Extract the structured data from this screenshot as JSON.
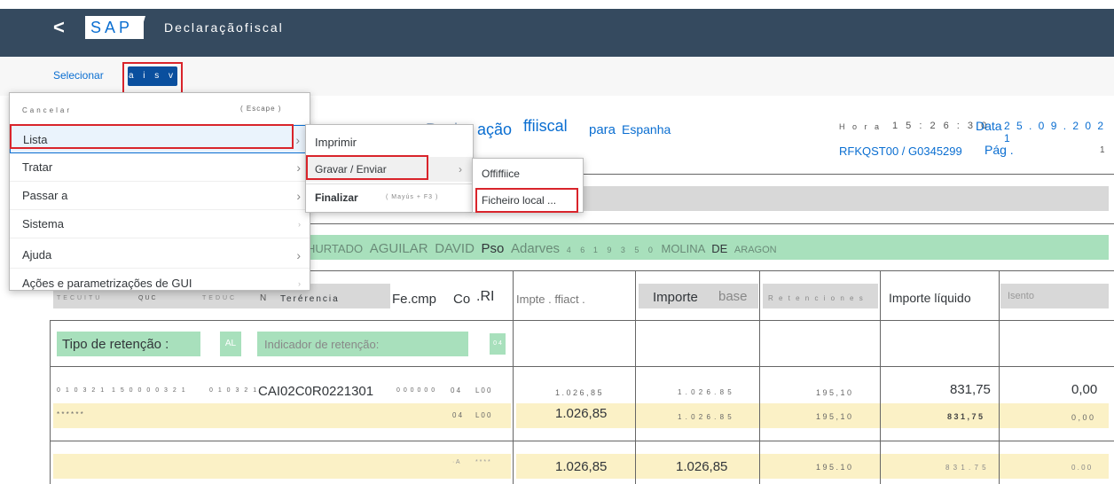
{
  "header": {
    "back_label": "<",
    "logo": "SAP",
    "title": "Declaraçãofiscal"
  },
  "toolbar": {
    "selecionar": "Selecionar",
    "mais": "a i s v"
  },
  "menu": {
    "items": [
      {
        "label": "Cancelar",
        "shortcut": "( Escape )"
      },
      {
        "label": "Lista"
      },
      {
        "label": "Tratar"
      },
      {
        "label": "Passar a"
      },
      {
        "label": "Sistema"
      },
      {
        "label": "Ajuda"
      },
      {
        "label": "Ações e parametrizações de GUI"
      }
    ]
  },
  "submenu1": {
    "items": [
      {
        "label": "Imprimir"
      },
      {
        "label": "Gravar / Enviar"
      },
      {
        "label": "Finalizar",
        "shortcut": "( Mayús + F3 )"
      }
    ]
  },
  "submenu2": {
    "items": [
      {
        "label": "Offiffiice"
      },
      {
        "label": "Ficheiro local ..."
      }
    ]
  },
  "report": {
    "title_a": "ação",
    "title_b": "ffiiscal",
    "title_c": "para",
    "title_d": "Espanha",
    "hora_label": "H o r a",
    "hora": "1 5 : 2 6 : 3 0",
    "data_label": "Data",
    "data": "2 5 . 0 9 . 2 0 2 1",
    "ref": "RFKQST00 / G0345299",
    "pag": "Pág .",
    "pag_num": "1",
    "vendor": {
      "a": "HURTADO",
      "b": "AGUILAR",
      "c": "DAVID",
      "d": "Pso",
      "e": "Adarves",
      "f": "4 6",
      "g": "1 9 3 5 0",
      "h": "MOLINA",
      "i": "DE",
      "j": "ARAGON"
    },
    "columns": {
      "referencia": "Terérencia",
      "fecmp": "Fe.cmp",
      "co": "Co",
      "ri": ".RI",
      "impte": "Impte . ffiact .",
      "importe": "Importe",
      "base": "base",
      "retenciones": "R e t e n c i o n e s",
      "liquido": "Importe líquido",
      "isento": "Isento",
      "dummy1": "TECUITU",
      "dummy2": "QUC",
      "dummy3": "TEDUC",
      "n": "N"
    },
    "retencao": {
      "tipo": "Tipo de retenção :",
      "al": "AL",
      "indicador": "Indicador de retenção:",
      "cod": "0 4"
    },
    "row1": {
      "a": "0 1 0 3 2 1",
      "b": "1 5 0 0 0 0 3 2 1",
      "c": "0 1 0 3 2 1",
      "doc": "CAI02C0R0221301",
      "d": "0 0 0 0 0 0",
      "e": "0 4",
      "f": "L 0 0",
      "impte": "1 . 0 2 6 , 8 5",
      "importe": "1 . 0 2 6 . 8 5",
      "ret": "1 9 5 , 1 0",
      "liq": "831,75",
      "isento": "0,00"
    },
    "row2": {
      "stars": "* * * * * *",
      "e": "0 4",
      "f": "L 0 0",
      "impte": "1.026,85",
      "importe": "1 . 0 2 6 . 8 5",
      "ret": "1 9 5 , 1 0",
      "liq": "8 3 1 , 7 5",
      "isento": "0 , 0 0"
    },
    "row3": {
      "a": "· A",
      "stars": "* * * *",
      "impte": "1.026,85",
      "importe": "1.026,85",
      "ret": "1 9 5 . 1 0",
      "liq": "8 3 1 . 7 5",
      "isento": "0 . 0 0"
    }
  }
}
